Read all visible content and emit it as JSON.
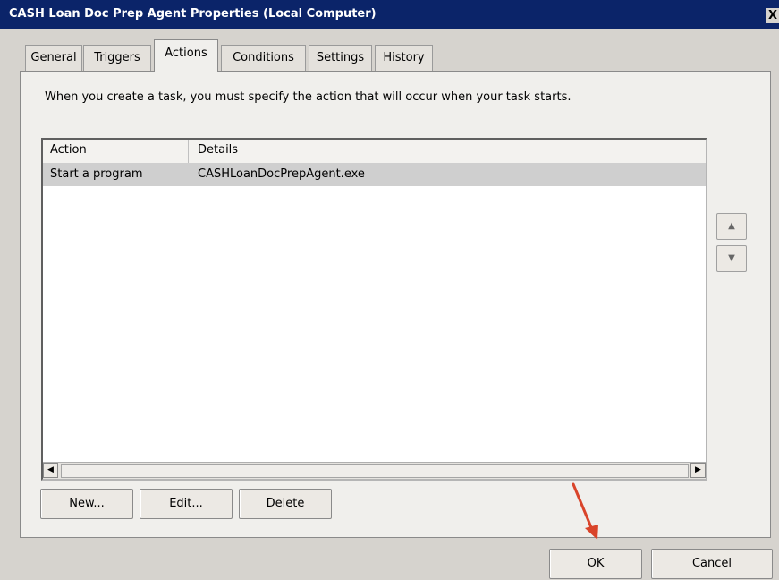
{
  "window": {
    "title": "CASH Loan Doc Prep Agent Properties (Local Computer)",
    "close_label": "X"
  },
  "tabs": [
    {
      "label": "General",
      "active": false
    },
    {
      "label": "Triggers",
      "active": false
    },
    {
      "label": "Actions",
      "active": true
    },
    {
      "label": "Conditions",
      "active": false
    },
    {
      "label": "Settings",
      "active": false
    },
    {
      "label": "History",
      "active": false
    }
  ],
  "actions_tab": {
    "instructions": "When you create a task, you must specify the action that will occur when your task starts.",
    "columns": [
      "Action",
      "Details"
    ],
    "rows": [
      {
        "action": "Start a program",
        "details": "CASHLoanDocPrepAgent.exe"
      }
    ],
    "buttons": {
      "new": "New...",
      "edit": "Edit...",
      "delete": "Delete"
    }
  },
  "dialog_buttons": {
    "ok": "OK",
    "cancel": "Cancel"
  },
  "icons": {
    "move_up": "move-up-icon",
    "move_down": "move-down-icon",
    "scroll_left": "scroll-left-icon",
    "scroll_right": "scroll-right-icon",
    "annotation_arrow": "red-arrow-annotation"
  },
  "colors": {
    "title_bar": "#0b2469",
    "annotation_arrow": "#d9442a",
    "selected_row": "#cfcfcf"
  }
}
